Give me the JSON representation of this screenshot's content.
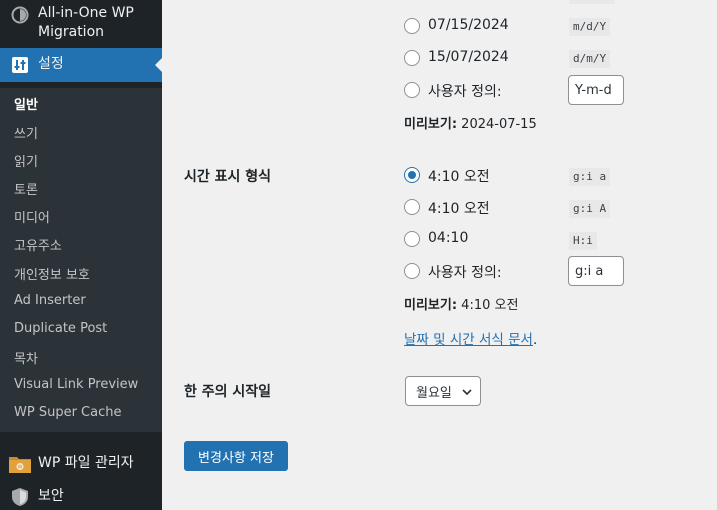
{
  "sidebar": {
    "plugin_label_line1": "All-in-One WP",
    "plugin_label_line2": "Migration",
    "settings_label": "설정",
    "submenu": [
      "일반",
      "쓰기",
      "읽기",
      "토론",
      "미디어",
      "고유주소",
      "개인정보 보호",
      "Ad Inserter",
      "Duplicate Post",
      "목차",
      "Visual Link Preview",
      "WP Super Cache"
    ],
    "file_manager_label": "WP 파일 관리자",
    "security_label": "보안"
  },
  "date_format": {
    "options": [
      {
        "label": "07/15/2024",
        "code": "m/d/Y"
      },
      {
        "label": "15/07/2024",
        "code": "d/m/Y"
      },
      {
        "label": "사용자 정의:",
        "input": "Y-m-d"
      }
    ],
    "preview_label": "미리보기:",
    "preview_value": " 2024-07-15"
  },
  "time_format": {
    "heading": "시간 표시 형식",
    "options": [
      {
        "label": "4:10 오전",
        "code": "g:i a",
        "checked": true
      },
      {
        "label": "4:10 오전",
        "code": "g:i A"
      },
      {
        "label": "04:10",
        "code": "H:i"
      },
      {
        "label": "사용자 정의:",
        "input": "g:i a"
      }
    ],
    "preview_label": "미리보기:",
    "preview_value": " 4:10 오전",
    "doc_link": "날짜 및 시간 서식 문서",
    "doc_link_suffix": "."
  },
  "week_start": {
    "heading": "한 주의 시작일",
    "selected": "월요일"
  },
  "save_button": "변경사항 저장",
  "colors": {
    "accent": "#2271b1",
    "sidebar": "#1d2327",
    "submenu": "#2c3338"
  }
}
